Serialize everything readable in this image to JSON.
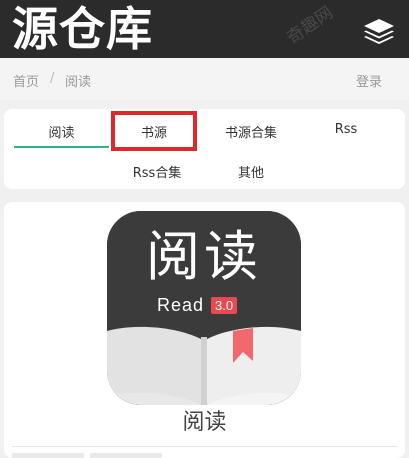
{
  "header": {
    "site_title": "源仓库",
    "menu_icon": "layers-icon",
    "watermark": "奇趣网"
  },
  "breadcrumb": {
    "home": "首页",
    "separator": "/",
    "current": "阅读",
    "login": "登录"
  },
  "tabs": [
    {
      "label": "阅读",
      "active": true
    },
    {
      "label": "书源",
      "highlighted": true
    },
    {
      "label": "书源合集"
    },
    {
      "label": "Rss"
    },
    {
      "label": "Rss合集"
    },
    {
      "label": "其他"
    }
  ],
  "app": {
    "name": "阅读",
    "icon_title": "阅读",
    "icon_subtitle": "Read",
    "icon_version": "3.0"
  },
  "colors": {
    "header_bg": "#2b2b2b",
    "tab_active_underline": "#2fb38c",
    "highlight_border": "#e0282c",
    "bookmark": "#f2686d"
  }
}
